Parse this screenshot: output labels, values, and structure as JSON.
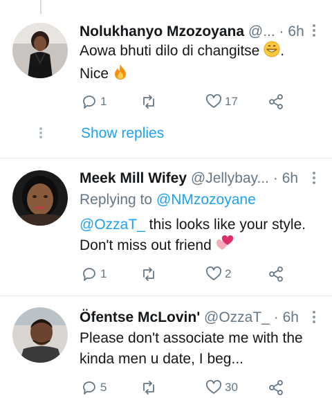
{
  "tweets": [
    {
      "name": "Nolukhanyo Mzozoyana",
      "handle": "@...",
      "separator": "·",
      "time": "6h",
      "text_line1": "Aowa bhuti dilo di changitse",
      "text_line2": "Nice",
      "reply_count": "1",
      "retweet_count": "",
      "like_count": "17"
    },
    {
      "name": "Meek Mill Wifey",
      "handle": "@Jellybay...",
      "separator": "·",
      "time": "6h",
      "replying_prefix": "Replying to",
      "replying_handle": "@NMzozoyane",
      "mention": "@OzzaT_",
      "text_line1_rest": " this looks like your style.",
      "text_line2": "Don't miss out friend",
      "reply_count": "1",
      "retweet_count": "",
      "like_count": "2"
    },
    {
      "name": "Öfentse McLovin'",
      "handle": "@OzzaT_",
      "separator": "·",
      "time": "6h",
      "text_line1": "Please don't associate me with the",
      "text_line2": "kinda men u date, I beg...",
      "reply_count": "5",
      "retweet_count": "",
      "like_count": "30"
    }
  ],
  "show_replies_label": "Show replies",
  "colors": {
    "link": "#1da1f2",
    "muted": "#657786",
    "divider": "#e1e8ed"
  },
  "icons": [
    "reply-icon",
    "retweet-icon",
    "like-icon",
    "share-icon",
    "more-icon",
    "grinning-emoji",
    "fire-emoji",
    "hearts-emoji"
  ]
}
